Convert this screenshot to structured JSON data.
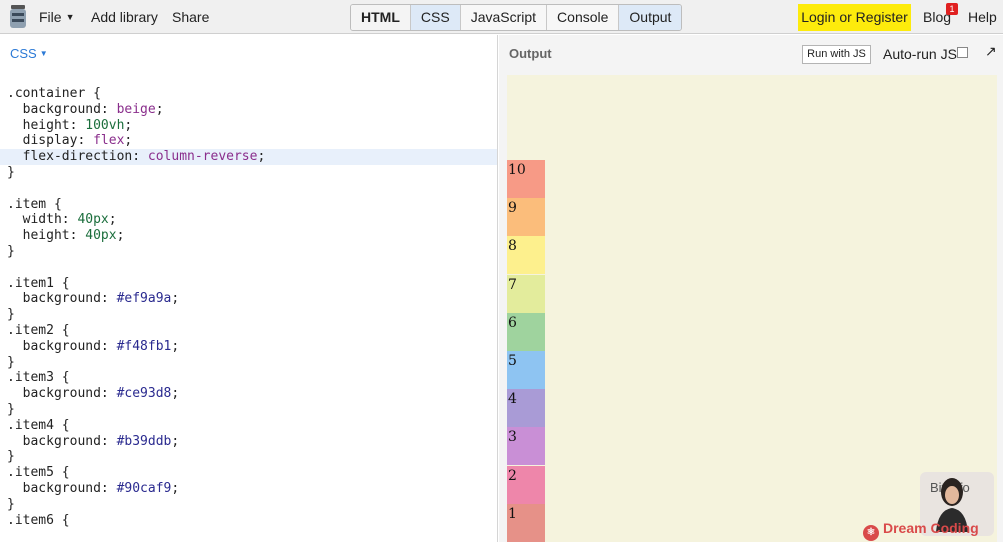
{
  "topbar": {
    "logo_icon": "jar-icon",
    "file_label": "File",
    "add_library_label": "Add library",
    "share_label": "Share",
    "tabs": [
      "HTML",
      "CSS",
      "JavaScript",
      "Console",
      "Output"
    ],
    "login_label": "Login or Register",
    "blog_label": "Blog",
    "blog_badge": "1",
    "help_label": "Help"
  },
  "editor": {
    "language": "CSS",
    "lines": [
      ".container {",
      "  background: beige;",
      "  height: 100vh;",
      "  display: flex;",
      "  flex-direction: column-reverse;",
      "}",
      "",
      ".item {",
      "  width: 40px;",
      "  height: 40px;",
      "}",
      "",
      ".item1 {",
      "  background: #ef9a9a;",
      "}",
      ".item2 {",
      "  background: #f48fb1;",
      "}",
      ".item3 {",
      "  background: #ce93d8;",
      "}",
      ".item4 {",
      "  background: #b39ddb;",
      "}",
      ".item5 {",
      "  background: #90caf9;",
      "}",
      ".item6 {"
    ]
  },
  "output": {
    "title": "Output",
    "run_label": "Run with JS",
    "autorun_label": "Auto-run JS",
    "items": [
      {
        "label": "10",
        "color": "#f79a86"
      },
      {
        "label": "9",
        "color": "#fbbd7b"
      },
      {
        "label": "8",
        "color": "#fdf08d"
      },
      {
        "label": "7",
        "color": "#e3ec9c"
      },
      {
        "label": "6",
        "color": "#9fd39e"
      },
      {
        "label": "5",
        "color": "#8ec4f2"
      },
      {
        "label": "4",
        "color": "#a99bd6"
      },
      {
        "label": "3",
        "color": "#c98fd6"
      },
      {
        "label": "2",
        "color": "#ee86aa"
      },
      {
        "label": "1",
        "color": "#e69188"
      }
    ]
  },
  "overlay": {
    "cam_text": "Bit.info",
    "watermark": "Dream Coding"
  },
  "colors": {
    "accent": "#2c7ad6",
    "login_bg": "#fdeb0c",
    "output_bg": "#f5f3dd"
  }
}
